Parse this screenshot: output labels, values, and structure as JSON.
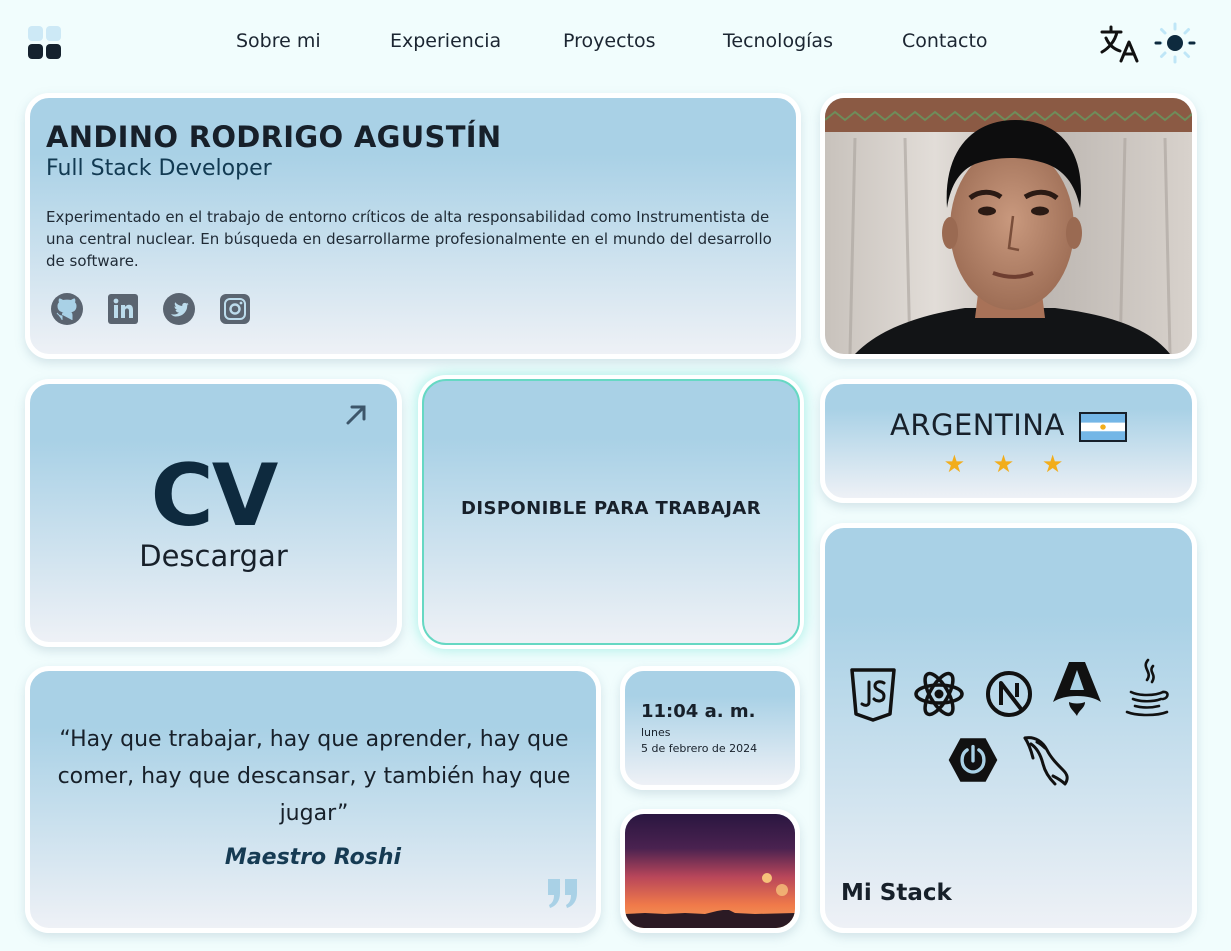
{
  "nav": {
    "items": [
      "Sobre mi",
      "Experiencia",
      "Proyectos",
      "Tecnologías",
      "Contacto"
    ],
    "translate_icon": "translate-icon",
    "theme_icon": "sun-icon"
  },
  "profile": {
    "name": "ANDINO RODRIGO AGUSTÍN",
    "role": "Full Stack Developer",
    "bio": "Experimentado en el trabajo de entorno críticos de alta responsabilidad como Instrumentista de una central nuclear. En búsqueda en desarrollarme profesionalmente en el mundo del desarrollo de software.",
    "socials": [
      "github-icon",
      "linkedin-icon",
      "twitter-icon",
      "instagram-icon"
    ]
  },
  "cv": {
    "title": "CV",
    "action": "Descargar"
  },
  "availability": {
    "label": "DISPONIBLE PARA TRABAJAR",
    "accent": "#66d8c3"
  },
  "country": {
    "name": "ARGENTINA",
    "stars": "★ ★ ★",
    "star_color": "#f2ad1b"
  },
  "stack": {
    "label": "Mi Stack",
    "icons": [
      "javascript-icon",
      "react-icon",
      "nextjs-icon",
      "astro-icon",
      "java-icon",
      "spring-icon",
      "mysql-icon"
    ]
  },
  "quote": {
    "text": "“Hay que trabajar, hay que aprender, hay que comer, hay que descansar, y también hay que jugar”",
    "author": "Maestro Roshi"
  },
  "clock": {
    "time": "11:04 a. m.",
    "weekday": "lunes",
    "date": "5 de febrero de 2024"
  },
  "colors": {
    "background": "#f1fdfd",
    "card_top": "#a9d1e6",
    "card_bottom": "#eef1f6",
    "text": "#17202a"
  }
}
